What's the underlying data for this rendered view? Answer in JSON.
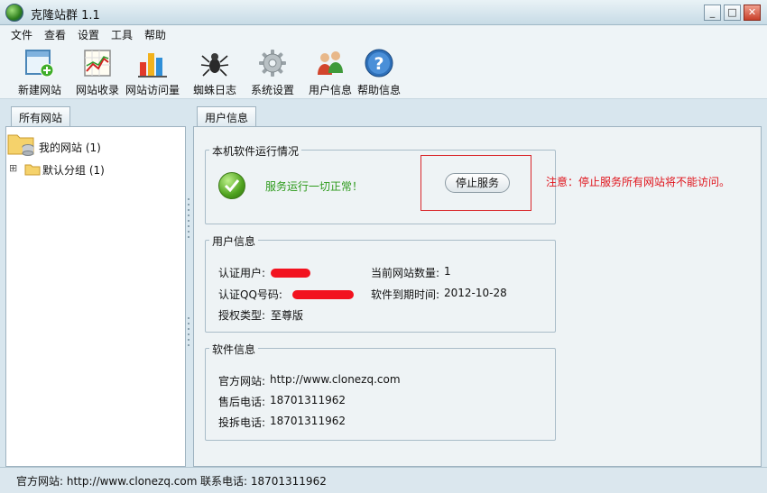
{
  "window": {
    "title": "克隆站群 1.1",
    "minimize": "_",
    "maximize": "□",
    "close": "✕"
  },
  "menu": [
    "文件",
    "查看",
    "设置",
    "工具",
    "帮助"
  ],
  "toolbar": [
    {
      "label": "新建网站",
      "icon": "new-site-icon"
    },
    {
      "label": "网站收录",
      "icon": "site-index-icon"
    },
    {
      "label": "网站访问量",
      "icon": "traffic-chart-icon"
    },
    {
      "label": "蜘蛛日志",
      "icon": "spider-icon"
    },
    {
      "label": "系统设置",
      "icon": "gear-icon"
    },
    {
      "label": "用户信息",
      "icon": "users-icon"
    },
    {
      "label": "帮助信息",
      "icon": "help-icon"
    }
  ],
  "left_tab": "所有网站",
  "tree": {
    "root": "我的网站 (1)",
    "expander": "⊞",
    "children": [
      "默认分组 (1)"
    ]
  },
  "right_tab": "用户信息",
  "run_status": {
    "group_title": "本机软件运行情况",
    "status_text": "服务运行一切正常！",
    "stop_button": "停止服务",
    "warning": "注意：停止服务所有网站将不能访问。"
  },
  "user_info": {
    "group_title": "用户信息",
    "auth_user_label": "认证用户:",
    "auth_qq_label": "认证QQ号码:",
    "license_label": "授权类型:",
    "license_value": "至尊版",
    "site_count_label": "当前网站数量:",
    "site_count_value": "1",
    "expire_label": "软件到期时间:",
    "expire_value": "2012-10-28"
  },
  "software_info": {
    "group_title": "软件信息",
    "website_label": "官方网站:",
    "website_value": "http://www.clonezq.com",
    "support_label": "售后电话:",
    "support_value": "18701311962",
    "complaint_label": "投拆电话:",
    "complaint_value": "18701311962"
  },
  "statusbar": {
    "website": "官方网站: http://www.clonezq.com",
    "phone": "联系电话: 18701311962"
  }
}
